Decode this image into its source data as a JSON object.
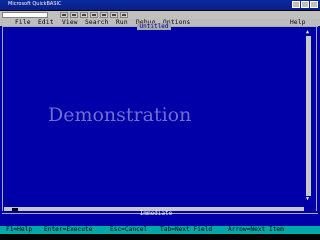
{
  "window": {
    "title": "Microsoft QuickBASIC"
  },
  "toolbar": {
    "buttons": [
      "open",
      "save",
      "cut",
      "copy",
      "paste",
      "undo",
      "help"
    ]
  },
  "menu": {
    "items": [
      "File",
      "Edit",
      "View",
      "Search",
      "Run",
      "Debug",
      "Options",
      "Help"
    ]
  },
  "editor": {
    "doc_title": "Untitled",
    "overlay_text": "Demonstration"
  },
  "immediate": {
    "label": "Immediate"
  },
  "status": {
    "items": [
      "F1=Help",
      "Enter=Execute",
      "Esc=Cancel",
      "Tab=Next Field",
      "Arrow=Next Item"
    ]
  },
  "colors": {
    "editor_bg": "#0000a8",
    "menubar_bg": "#bdbdbd",
    "statusbar_bg": "#00a8a8",
    "overlay_text": "#6f6fd0"
  }
}
